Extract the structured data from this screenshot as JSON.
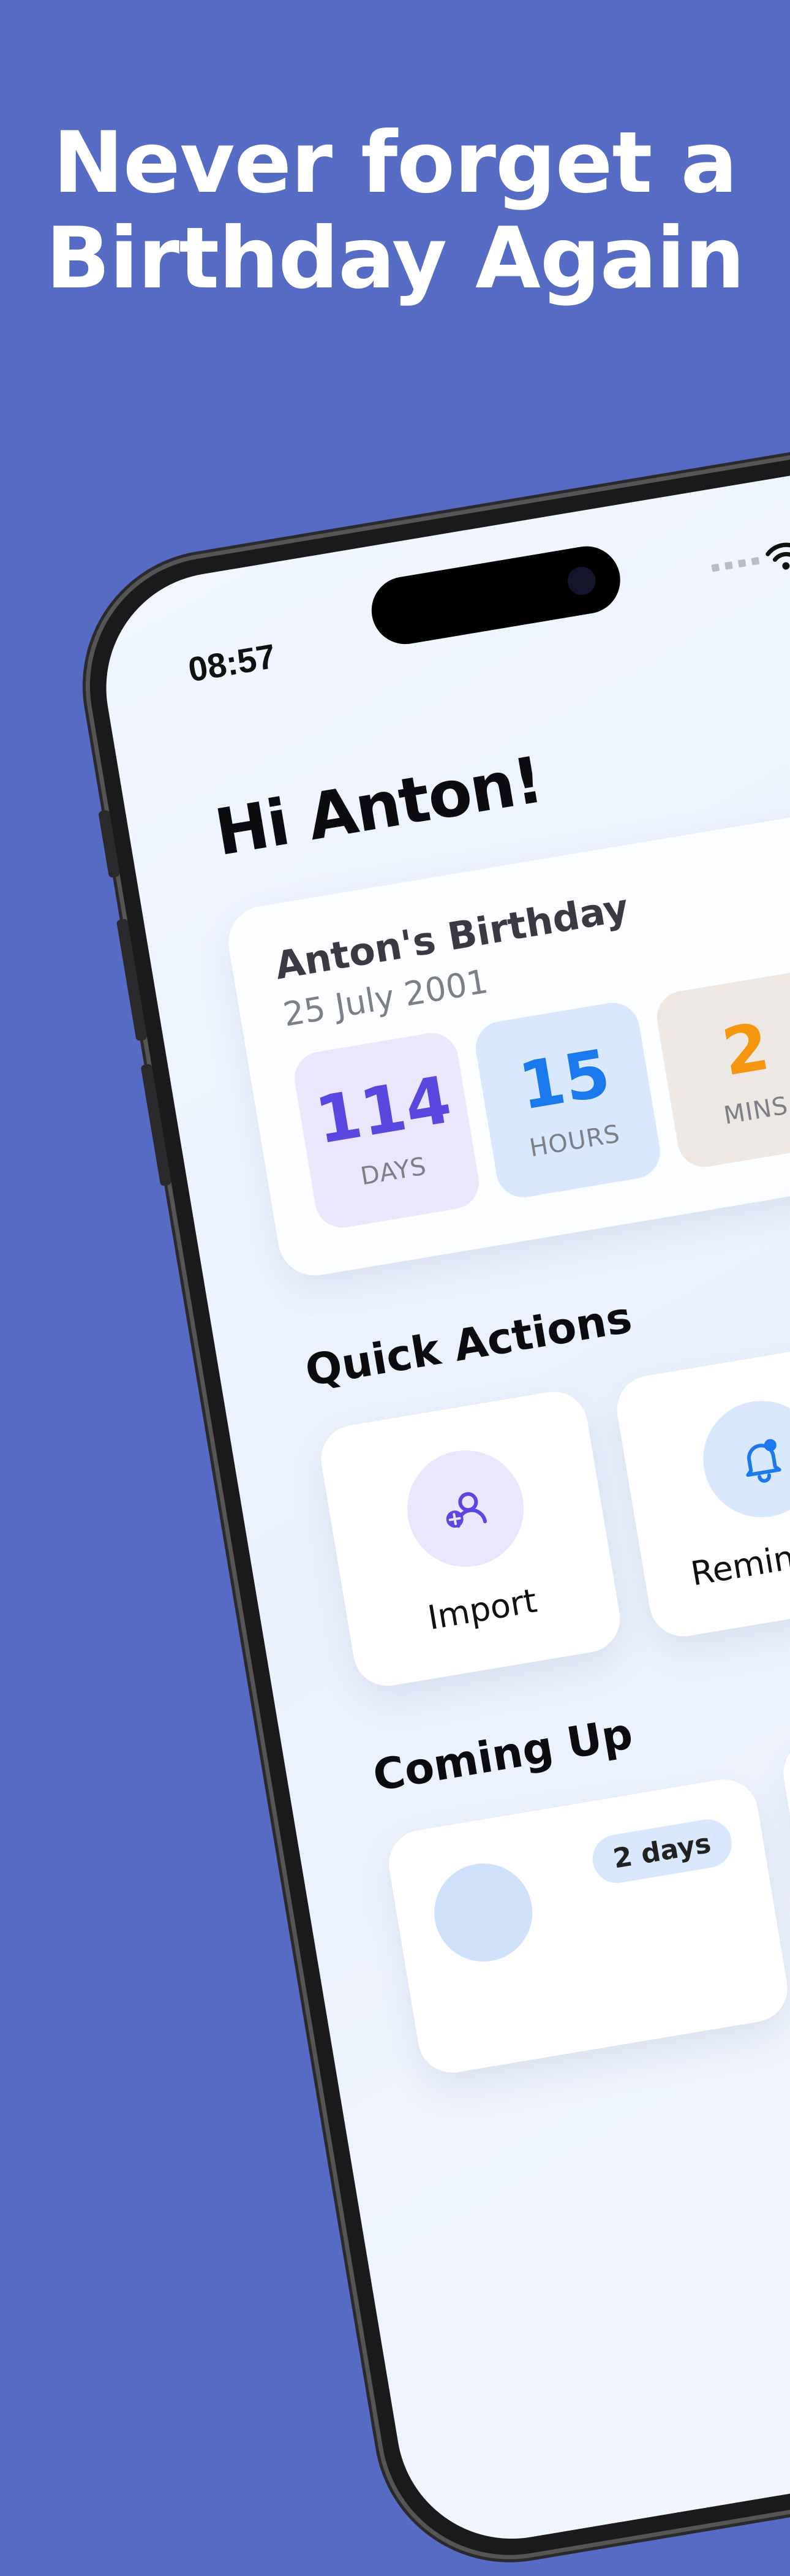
{
  "headline": {
    "line1": "Never forget a",
    "line2": "Birthday Again"
  },
  "status_bar": {
    "time": "08:57"
  },
  "greeting": "Hi Anton!",
  "birthday_card": {
    "name": "Anton's Birthday",
    "date": "25 July 2001",
    "countdown": [
      {
        "value": "114",
        "unit": "DAYS"
      },
      {
        "value": "15",
        "unit": "HOURS"
      },
      {
        "value": "2",
        "unit": "MINS"
      }
    ]
  },
  "quick_actions": {
    "title": "Quick Actions",
    "items": [
      {
        "label": "Import",
        "icon": "add-contact-icon"
      },
      {
        "label": "Reminders",
        "icon": "bell-icon"
      }
    ]
  },
  "coming_up": {
    "title": "Coming Up",
    "items": [
      {
        "badge": "2 days"
      }
    ]
  },
  "colors": {
    "background": "#566bc4",
    "days": "#5a47e0",
    "hours": "#1a7aed",
    "mins": "#f5960e"
  }
}
